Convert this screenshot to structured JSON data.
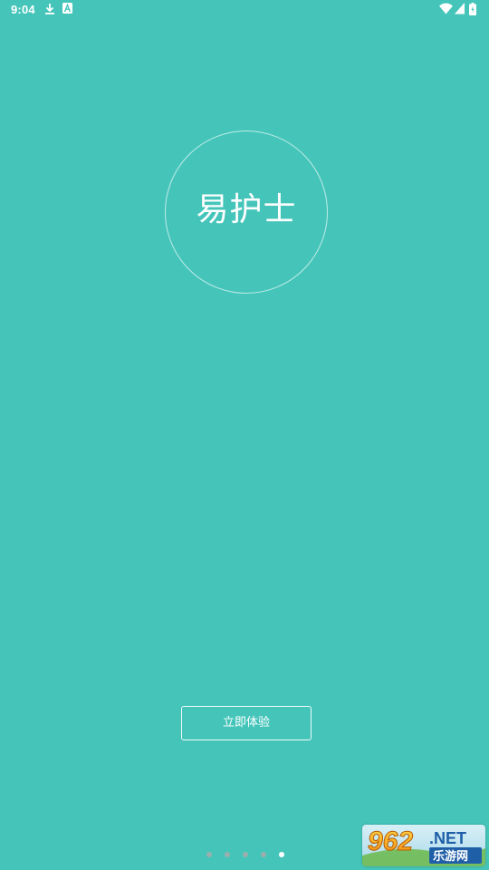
{
  "status_bar": {
    "time": "9:04",
    "left_icons": [
      "download-icon",
      "a-notification-icon"
    ],
    "right_icons": [
      "wifi-icon",
      "signal-icon",
      "battery-icon"
    ]
  },
  "logo": {
    "text": "易护士"
  },
  "cta": {
    "label": "立即体验"
  },
  "pager": {
    "total": 5,
    "active_index": 4
  },
  "watermark": {
    "number": "962",
    "domain": ".NET",
    "site_name": "乐游网"
  },
  "colors": {
    "background": "#45c5ba",
    "foreground": "#ffffff",
    "dot_inactive": "#aaaaaa"
  }
}
